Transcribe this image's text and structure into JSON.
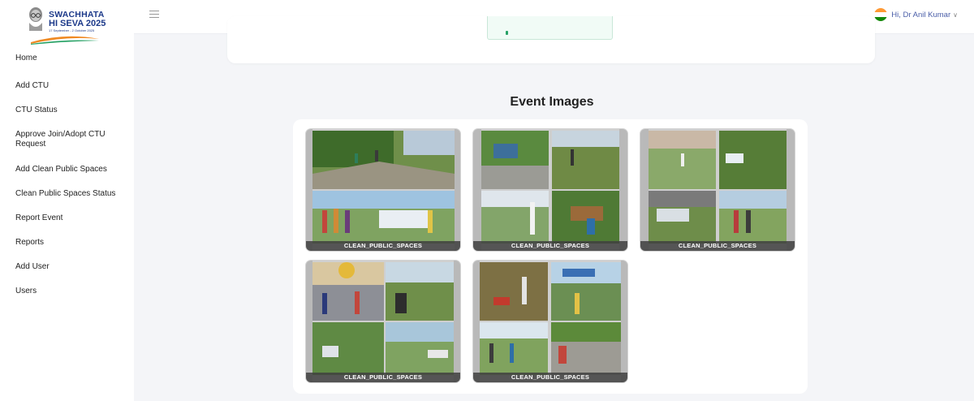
{
  "logo": {
    "line1": "SWACHHATA",
    "line2": "HI SEVA 2025",
    "line3": "17 September - 2 October 2025"
  },
  "sidebar": {
    "items": [
      {
        "label": "Home"
      },
      {
        "label": "Add CTU"
      },
      {
        "label": "CTU Status"
      },
      {
        "label": "Approve Join/Adopt CTU Request"
      },
      {
        "label": "Add Clean Public Spaces"
      },
      {
        "label": "Clean Public Spaces Status"
      },
      {
        "label": "Report Event"
      },
      {
        "label": "Reports"
      },
      {
        "label": "Add User"
      },
      {
        "label": "Users"
      }
    ]
  },
  "header": {
    "greeting": "Hi, Dr Anil Kumar",
    "chevron": "∨",
    "flag_colors": [
      "#ff9933",
      "#ffffff",
      "#138808"
    ]
  },
  "main": {
    "section_title": "Event Images",
    "images": [
      {
        "caption": "CLEAN_PUBLIC_SPACES"
      },
      {
        "caption": "CLEAN_PUBLIC_SPACES"
      },
      {
        "caption": "CLEAN_PUBLIC_SPACES"
      },
      {
        "caption": "CLEAN_PUBLIC_SPACES"
      },
      {
        "caption": "CLEAN_PUBLIC_SPACES"
      }
    ]
  },
  "colors": {
    "accent": "#4a5ea8",
    "brand_blue": "#1d3a8a",
    "saffron": "#f08a24",
    "green": "#27a266"
  }
}
